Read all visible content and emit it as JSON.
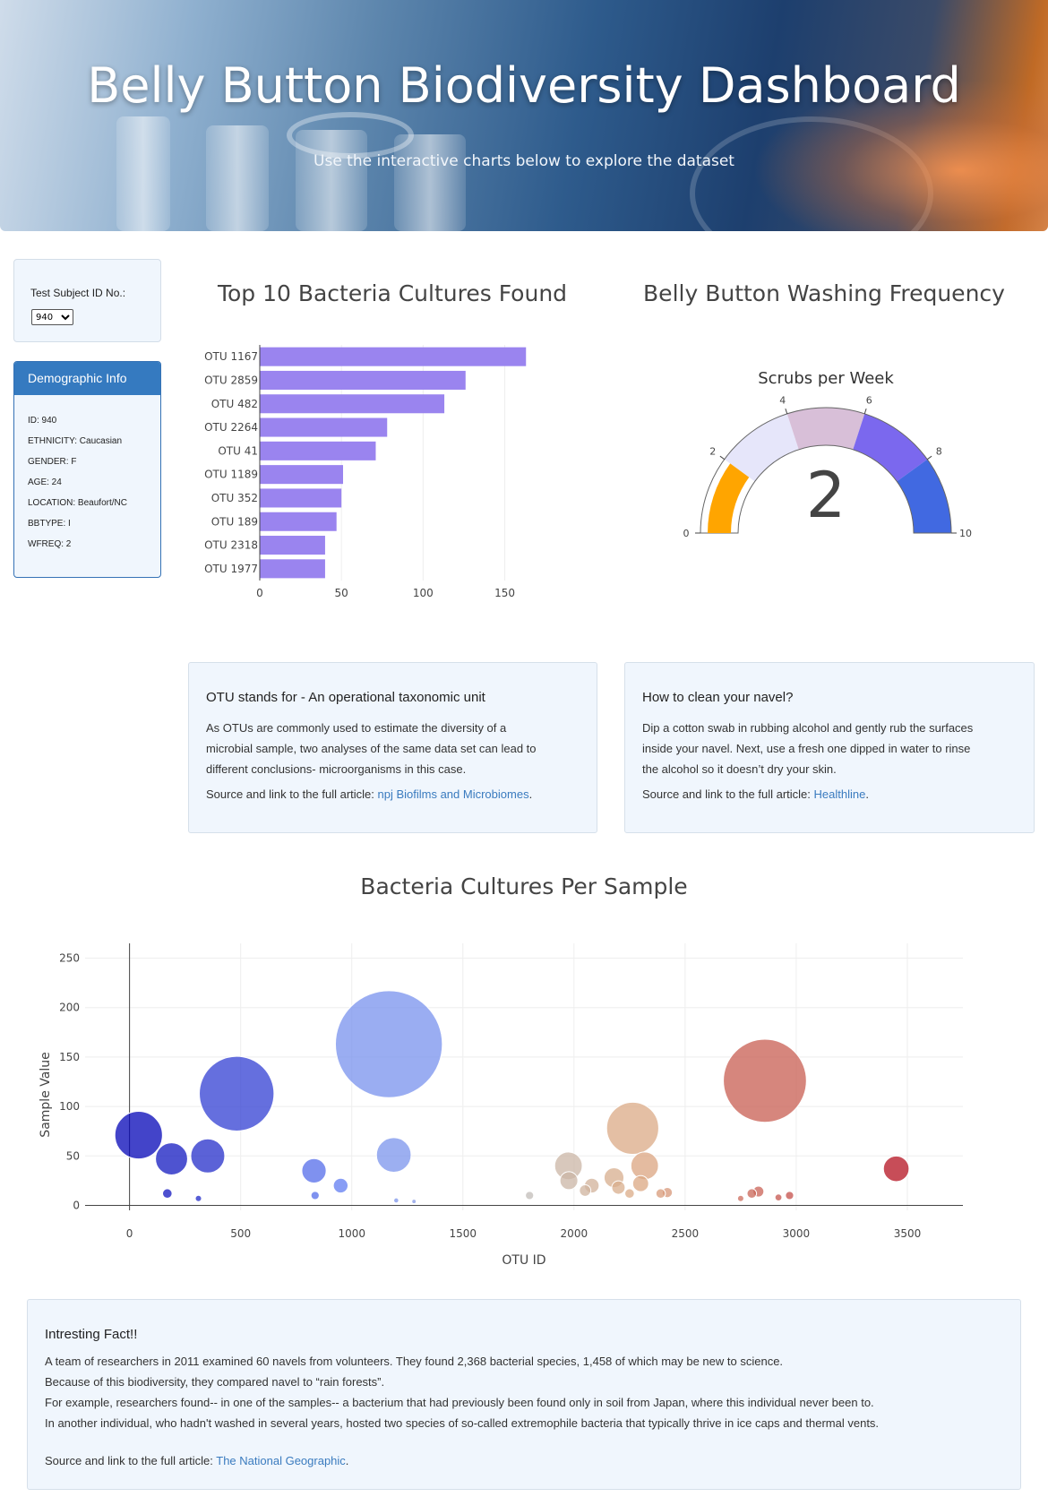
{
  "header": {
    "title": "Belly Button Biodiversity Dashboard",
    "subtitle": "Use the interactive charts below to explore the dataset"
  },
  "selector": {
    "label": "Test Subject ID No.:",
    "selected": "940"
  },
  "demographics": {
    "title": "Demographic Info",
    "rows": [
      "ID: 940",
      "ETHNICITY: Caucasian",
      "GENDER: F",
      "AGE: 24",
      "LOCATION: Beaufort/NC",
      "BBTYPE: I",
      "WFREQ: 2"
    ]
  },
  "charts_titles": {
    "bar": "Top 10 Bacteria Cultures Found",
    "gauge": "Belly Button Washing Frequency",
    "bubble": "Bacteria Cultures Per Sample"
  },
  "info_otu": {
    "heading": "OTU stands for - An operational taxonomic unit",
    "lines": [
      "As OTUs are commonly used to estimate the diversity of a",
      "microbial sample, two analyses of the same data set can lead to",
      "different conclusions- microorganisms in this case."
    ],
    "source_prefix": "Source and link to the full article: ",
    "link": "npj Biofilms and Microbiomes",
    "suffix": "."
  },
  "info_navel": {
    "heading": "How to clean your navel?",
    "lines": [
      "Dip a cotton swab in rubbing alcohol and gently rub the surfaces",
      "inside your navel. Next, use a fresh one dipped in water to rinse",
      "the alcohol so it doesn’t dry your skin."
    ],
    "source_prefix": "Source and link to the full article: ",
    "link": "Healthline",
    "suffix": "."
  },
  "fact": {
    "heading": "Intresting Fact!!",
    "lines": [
      "A team of researchers in 2011 examined 60 navels from volunteers. They found 2,368 bacterial species, 1,458 of which may be new to science.",
      "Because of this biodiversity, they compared navel to “rain forests”.",
      "For example, researchers found-- in one of the samples-- a bacterium that had previously been found only in soil from Japan, where this individual never been to.",
      "In another individual, who hadn't washed in several years, hosted two species of so-called extremophile bacteria that typically thrive in ice caps and thermal vents."
    ],
    "source_prefix": "Source and link to the full article: ",
    "link": "The National Geographic",
    "suffix": "."
  },
  "chart_data": [
    {
      "type": "bar",
      "orientation": "horizontal",
      "title": "Top 10 Bacteria Cultures Found",
      "categories": [
        "OTU 1167",
        "OTU 2859",
        "OTU 482",
        "OTU 2264",
        "OTU 41",
        "OTU 1189",
        "OTU 352",
        "OTU 189",
        "OTU 2318",
        "OTU 1977"
      ],
      "values": [
        163,
        126,
        113,
        78,
        71,
        51,
        50,
        47,
        40,
        40
      ],
      "xticks": [
        0,
        50,
        100,
        150
      ],
      "xlim": [
        0,
        170
      ],
      "color": "#9a84ef"
    },
    {
      "type": "gauge",
      "title": "Scrubs per Week",
      "value": 2,
      "range": [
        0,
        10
      ],
      "ticks": [
        0,
        2,
        4,
        6,
        8,
        10
      ],
      "bands": [
        {
          "from": 0,
          "to": 2,
          "color": "#ffffff"
        },
        {
          "from": 2,
          "to": 4,
          "color": "#e6e6fa"
        },
        {
          "from": 4,
          "to": 6,
          "color": "#d8bfd8"
        },
        {
          "from": 6,
          "to": 8,
          "color": "#7b68ee"
        },
        {
          "from": 8,
          "to": 10,
          "color": "#4169e1"
        }
      ],
      "bar_color": "#ffa500"
    },
    {
      "type": "scatter",
      "title": "Bacteria Cultures Per Sample",
      "xlabel": "OTU ID",
      "ylabel": "Sample Value",
      "xticks": [
        0,
        500,
        1000,
        1500,
        2000,
        2500,
        3000,
        3500
      ],
      "yticks": [
        0,
        50,
        100,
        150,
        200,
        250
      ],
      "xlim": [
        -200,
        3750
      ],
      "ylim": [
        -5,
        265
      ],
      "points": [
        {
          "x": 41,
          "y": 71
        },
        {
          "x": 189,
          "y": 47
        },
        {
          "x": 352,
          "y": 50
        },
        {
          "x": 482,
          "y": 113
        },
        {
          "x": 170,
          "y": 12
        },
        {
          "x": 310,
          "y": 7
        },
        {
          "x": 830,
          "y": 35
        },
        {
          "x": 950,
          "y": 20
        },
        {
          "x": 835,
          "y": 10
        },
        {
          "x": 1167,
          "y": 163
        },
        {
          "x": 1189,
          "y": 51
        },
        {
          "x": 1200,
          "y": 5
        },
        {
          "x": 1280,
          "y": 4
        },
        {
          "x": 1800,
          "y": 10
        },
        {
          "x": 1975,
          "y": 40
        },
        {
          "x": 1977,
          "y": 25
        },
        {
          "x": 2050,
          "y": 15
        },
        {
          "x": 2080,
          "y": 20
        },
        {
          "x": 2180,
          "y": 28
        },
        {
          "x": 2200,
          "y": 18
        },
        {
          "x": 2264,
          "y": 78
        },
        {
          "x": 2300,
          "y": 22
        },
        {
          "x": 2318,
          "y": 40
        },
        {
          "x": 2250,
          "y": 12
        },
        {
          "x": 2390,
          "y": 12
        },
        {
          "x": 2420,
          "y": 13
        },
        {
          "x": 2750,
          "y": 7
        },
        {
          "x": 2800,
          "y": 12
        },
        {
          "x": 2830,
          "y": 14
        },
        {
          "x": 2859,
          "y": 126
        },
        {
          "x": 2920,
          "y": 8
        },
        {
          "x": 2970,
          "y": 10
        },
        {
          "x": 3450,
          "y": 37
        }
      ],
      "colorscale": "Bluered (light)"
    }
  ]
}
